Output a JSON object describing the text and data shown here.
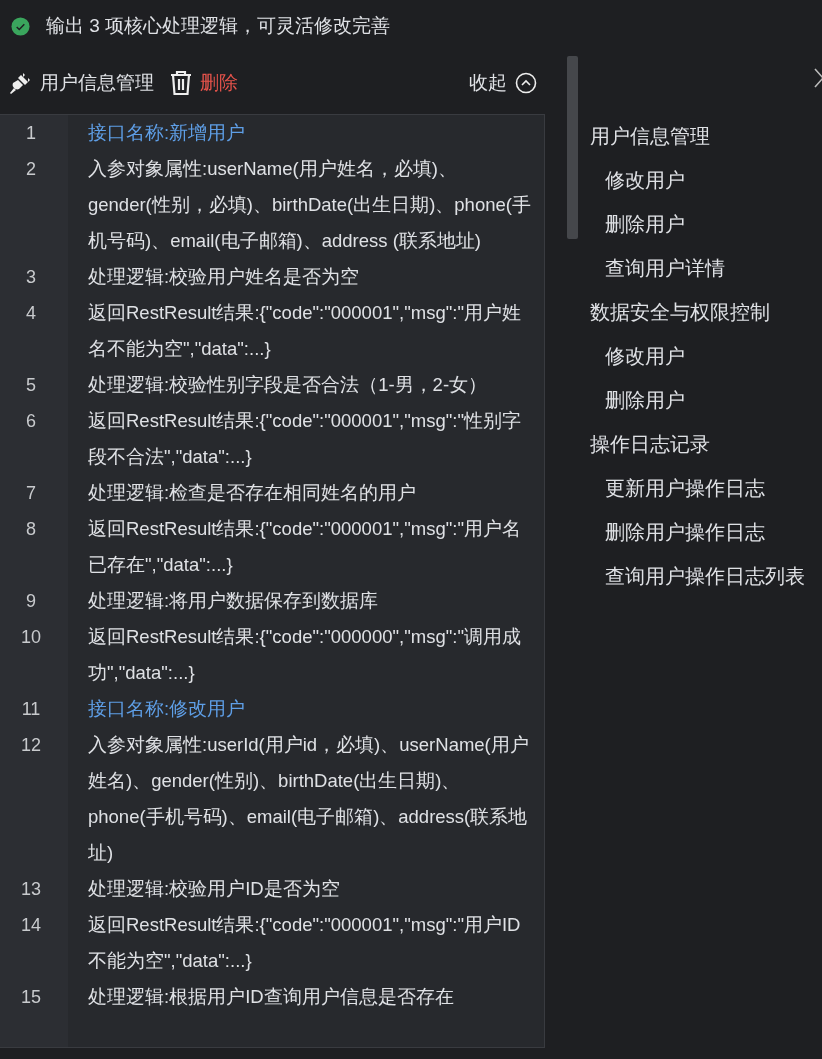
{
  "status": {
    "done": true,
    "text": "输出 3 项核心处理逻辑，可灵活修改完善"
  },
  "toolbar": {
    "title": "用户信息管理",
    "delete_label": "删除",
    "collapse_label": "收起"
  },
  "code_lines": [
    {
      "number": "1",
      "kind": "heading",
      "text": "接口名称:新增用户"
    },
    {
      "number": "2",
      "kind": "text",
      "text": "入参对象属性:userName(用户姓名，必填)、gender(性别，必填)、birthDate(出生日期)、phone(手机号码)、email(电子邮箱)、address (联系地址)"
    },
    {
      "number": "3",
      "kind": "text",
      "text": "处理逻辑:校验用户姓名是否为空"
    },
    {
      "number": "4",
      "kind": "text",
      "text": "返回RestResult结果:{\"code\":\"000001\",\"msg\":\"用户姓名不能为空\",\"data\":...}"
    },
    {
      "number": "5",
      "kind": "text",
      "text": "处理逻辑:校验性别字段是否合法（1-男，2-女）"
    },
    {
      "number": "6",
      "kind": "text",
      "text": "返回RestResult结果:{\"code\":\"000001\",\"msg\":\"性别字段不合法\",\"data\":...}"
    },
    {
      "number": "7",
      "kind": "text",
      "text": "处理逻辑:检查是否存在相同姓名的用户"
    },
    {
      "number": "8",
      "kind": "text",
      "text": "返回RestResult结果:{\"code\":\"000001\",\"msg\":\"用户名已存在\",\"data\":...}"
    },
    {
      "number": "9",
      "kind": "text",
      "text": "处理逻辑:将用户数据保存到数据库"
    },
    {
      "number": "10",
      "kind": "text",
      "text": "返回RestResult结果:{\"code\":\"000000\",\"msg\":\"调用成功\",\"data\":...}"
    },
    {
      "number": "11",
      "kind": "heading",
      "text": "接口名称:修改用户"
    },
    {
      "number": "12",
      "kind": "text",
      "text": "入参对象属性:userId(用户id，必填)、userName(用户姓名)、gender(性别)、birthDate(出生日期)、phone(手机号码)、email(电子邮箱)、address(联系地址)"
    },
    {
      "number": "13",
      "kind": "text",
      "text": "处理逻辑:校验用户ID是否为空"
    },
    {
      "number": "14",
      "kind": "text",
      "text": "返回RestResult结果:{\"code\":\"000001\",\"msg\":\"用户ID不能为空\",\"data\":...}"
    },
    {
      "number": "15",
      "kind": "text",
      "text": "处理逻辑:根据用户ID查询用户信息是否存在"
    }
  ],
  "outline": [
    {
      "label": "用户信息管理",
      "children": [
        {
          "label": "修改用户"
        },
        {
          "label": "删除用户"
        },
        {
          "label": "查询用户详情"
        }
      ]
    },
    {
      "label": "数据安全与权限控制",
      "children": [
        {
          "label": "修改用户"
        },
        {
          "label": "删除用户"
        }
      ]
    },
    {
      "label": "操作日志记录",
      "children": [
        {
          "label": "更新用户操作日志"
        },
        {
          "label": "删除用户操作日志"
        },
        {
          "label": "查询用户操作日志列表"
        }
      ]
    }
  ]
}
